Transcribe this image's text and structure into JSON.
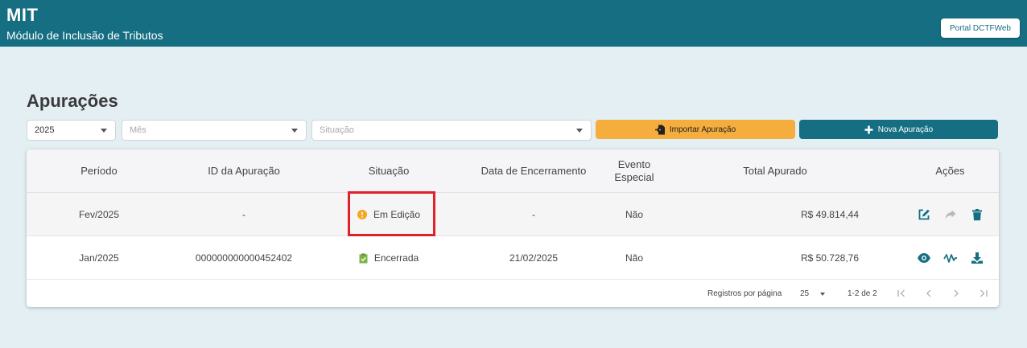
{
  "header": {
    "title": "MIT",
    "subtitle": "Módulo de Inclusão de Tributos",
    "portal_button": "Portal DCTFWeb",
    "bg_color": "#156e82"
  },
  "page": {
    "title": "Apurações"
  },
  "filters": {
    "year": {
      "value": "2025"
    },
    "month": {
      "placeholder": "Mês"
    },
    "status": {
      "placeholder": "Situação"
    }
  },
  "buttons": {
    "import": {
      "label": "Importar Apuração",
      "icon": "file-import-icon",
      "color": "#f5ae3e"
    },
    "new": {
      "label": "Nova Apuração",
      "icon": "plus-icon",
      "color": "#156e82"
    }
  },
  "table": {
    "columns": [
      "Período",
      "ID da Apuração",
      "Situação",
      "Data de Encerramento",
      "Evento\nEspecial",
      "Total Apurado",
      "Ações"
    ],
    "rows": [
      {
        "periodo": "Fev/2025",
        "id": "-",
        "situacao": "Em Edição",
        "situacao_icon": "warning-circle-icon",
        "data_encerramento": "-",
        "evento_especial": "Não",
        "total": "R$ 49.814,44",
        "actions": [
          "edit-icon",
          "share-icon",
          "trash-icon"
        ]
      },
      {
        "periodo": "Jan/2025",
        "id": "000000000000452402",
        "situacao": "Encerrada",
        "situacao_icon": "clipboard-check-icon",
        "data_encerramento": "21/02/2025",
        "evento_especial": "Não",
        "total": "R$ 50.728,76",
        "actions": [
          "eye-icon",
          "activity-icon",
          "download-icon"
        ]
      }
    ]
  },
  "pagination": {
    "rows_per_page_label": "Registros por página",
    "rows_per_page": "25",
    "range": "1-2 de 2"
  },
  "colors": {
    "accent": "#156e82",
    "warning": "#f5a623",
    "success": "#7cb342",
    "highlight": "#e0202a"
  }
}
